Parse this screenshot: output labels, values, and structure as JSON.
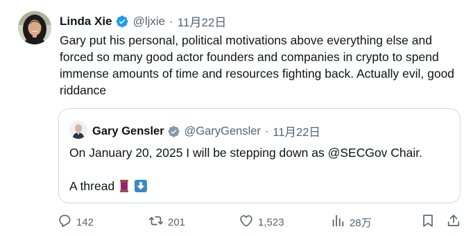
{
  "tweet": {
    "author": {
      "name": "Linda Xie",
      "handle": "@ljxie",
      "date": "11月22日"
    },
    "separator": "·",
    "text": "Gary put his personal, political motivations above everything else and forced so many good actor founders and companies in crypto to spend immense amounts of time and resources fighting back. Actually evil, good riddance"
  },
  "quote": {
    "author": {
      "name": "Gary Gensler",
      "handle": "@GaryGensler",
      "date": "11月22日"
    },
    "separator": "·",
    "text": "On January 20, 2025 I will be stepping down as @SECGov Chair.",
    "text2": "A thread"
  },
  "actions": {
    "replies": "142",
    "reposts": "201",
    "likes": "1,523",
    "views": "28万"
  },
  "colors": {
    "verified_blue": "#1d9bf0",
    "verified_gray": "#829aab",
    "muted_text": "#536471",
    "border": "#cfd9de"
  },
  "icons": [
    "verified-badge-icon",
    "reply-icon",
    "repost-icon",
    "like-icon",
    "views-icon",
    "bookmark-icon",
    "share-icon",
    "spool-emoji",
    "down-arrow-emoji"
  ]
}
